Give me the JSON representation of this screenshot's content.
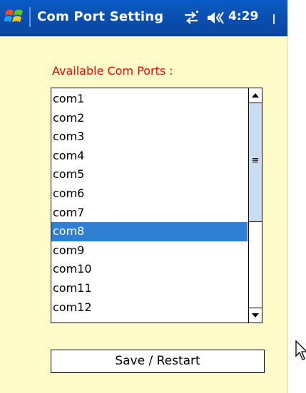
{
  "titlebar": {
    "title": "Com Port Setting",
    "clock": "4:29",
    "colors": {
      "bar": "#0a4fb0",
      "text": "#ffffff"
    }
  },
  "ports": {
    "label": "Available Com Ports :",
    "label_color": "#ff0000",
    "items": [
      "com1",
      "com2",
      "com3",
      "com4",
      "com5",
      "com6",
      "com7",
      "com8",
      "com9",
      "com10",
      "com11",
      "com12"
    ],
    "selected": "com8",
    "selected_color": "#2f80d3"
  },
  "actions": {
    "save_label": "Save / Restart"
  },
  "icons": [
    "windows-start-icon",
    "connectivity-icon",
    "volume-icon",
    "scroll-up-icon",
    "scroll-down-icon",
    "mouse-cursor-icon"
  ]
}
